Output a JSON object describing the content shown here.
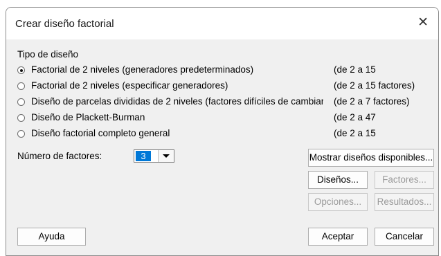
{
  "window": {
    "title": "Crear diseño factorial",
    "close_symbol": "✕"
  },
  "design_type": {
    "label": "Tipo de diseño",
    "options": [
      {
        "label": "Factorial de 2 niveles (generadores predeterminados)",
        "range": "(de 2 a 15",
        "selected": true
      },
      {
        "label": "Factorial de 2 niveles (especificar generadores)",
        "range": "(de 2 a 15 factores)",
        "selected": false
      },
      {
        "label": "Diseño de parcelas divididas de 2 niveles (factores difíciles de cambiar",
        "range": "(de 2 a 7 factores)",
        "selected": false
      },
      {
        "label": "Diseño de Plackett-Burman",
        "range": "(de 2 a 47",
        "selected": false
      },
      {
        "label": "Diseño factorial completo general",
        "range": "(de 2 a 15",
        "selected": false
      }
    ]
  },
  "factors": {
    "label": "Número de factores:",
    "value": "3"
  },
  "buttons": {
    "show_designs": "Mostrar diseños disponibles...",
    "designs": "Diseños...",
    "factors": "Factores...",
    "options": "Opciones...",
    "results": "Resultados...",
    "help": "Ayuda",
    "ok": "Aceptar",
    "cancel": "Cancelar"
  },
  "colors": {
    "selection": "#0078d7",
    "dialog_bg": "#f0f0f0",
    "disabled_text": "#9a9a9a"
  }
}
